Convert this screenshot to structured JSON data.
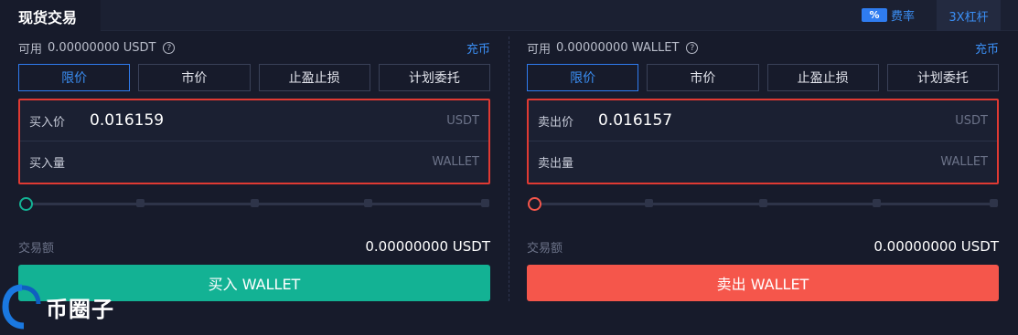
{
  "header": {
    "title": "现货交易",
    "fee_badge": "%",
    "fee_label": "费率",
    "leverage_label": "3X杠杆"
  },
  "buy": {
    "available_label": "可用",
    "available_value": "0.00000000 USDT",
    "deposit_label": "充币",
    "tabs": [
      {
        "label": "限价",
        "active": true
      },
      {
        "label": "市价",
        "active": false
      },
      {
        "label": "止盈止损",
        "active": false
      },
      {
        "label": "计划委托",
        "active": false
      }
    ],
    "price_label": "买入价",
    "price_value": "0.016159",
    "price_unit": "USDT",
    "qty_label": "买入量",
    "qty_value": "",
    "qty_unit": "WALLET",
    "slider_level": 0,
    "amount_label": "交易额",
    "amount_value": "0.00000000 USDT",
    "button_label": "买入 WALLET",
    "accent_color": "#13b294"
  },
  "sell": {
    "available_label": "可用",
    "available_value": "0.00000000 WALLET",
    "deposit_label": "充币",
    "tabs": [
      {
        "label": "限价",
        "active": true
      },
      {
        "label": "市价",
        "active": false
      },
      {
        "label": "止盈止损",
        "active": false
      },
      {
        "label": "计划委托",
        "active": false
      }
    ],
    "price_label": "卖出价",
    "price_value": "0.016157",
    "price_unit": "USDT",
    "qty_label": "卖出量",
    "qty_value": "",
    "qty_unit": "WALLET",
    "slider_level": 0,
    "amount_label": "交易额",
    "amount_value": "0.00000000 USDT",
    "button_label": "卖出 WALLET",
    "accent_color": "#f5564b"
  },
  "watermark": {
    "text": "币圈子",
    "icon": "coin-logo-icon"
  }
}
